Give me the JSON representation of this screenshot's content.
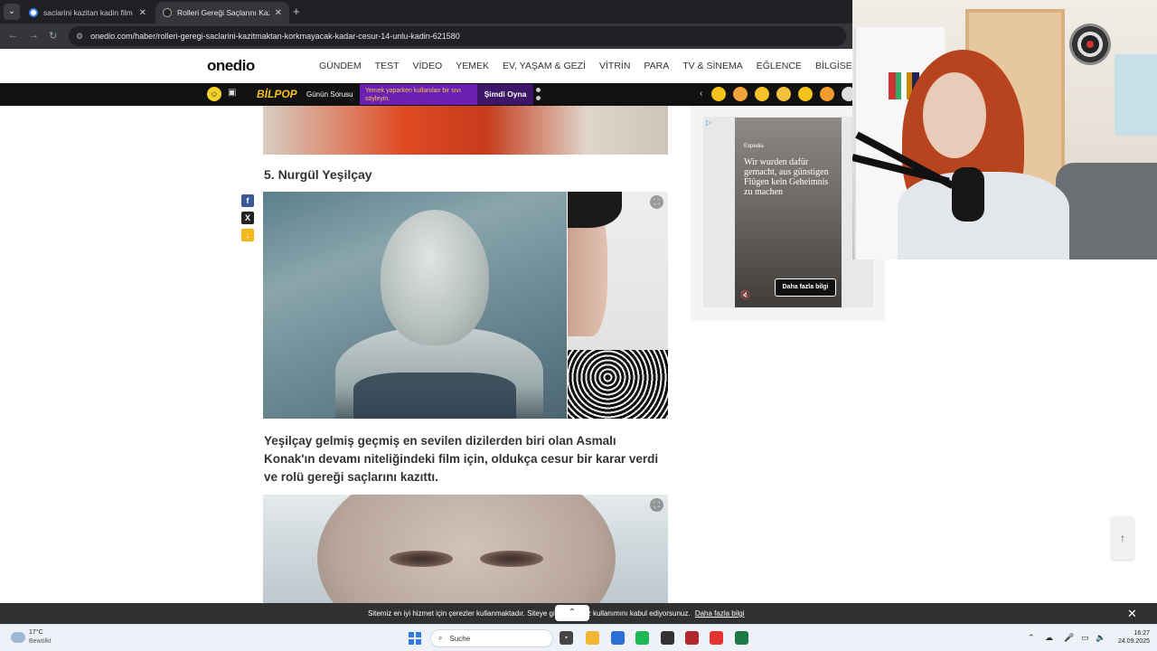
{
  "browser": {
    "tabs": [
      {
        "title": "saclarini kazitan kadin film kara",
        "active": false
      },
      {
        "title": "Rolleri Gereği Saçlarını Kazıtm",
        "active": true
      }
    ],
    "new_tab_icon": "+",
    "url": "onedio.com/haber/rolleri-geregi-saclarini-kazitmaktan-korkmayacak-kadar-cesur-14-unlu-kadin-621580"
  },
  "site": {
    "logo": "onedio",
    "nav": [
      "GÜNDEM",
      "TEST",
      "VİDEO",
      "YEMEK",
      "EV, YAŞAM & GEZİ",
      "VİTRİN",
      "PARA",
      "TV & SİNEMA",
      "EĞLENCE",
      "BİLGİSEL"
    ]
  },
  "promo": {
    "brand": "BİLPOP",
    "label": "Günün Sorusu",
    "question": "Yemek yaparken kullanılan bir sıvı söyleyin.",
    "play_label": "Şimdi Oyna",
    "emoji_colors": [
      "#f6c21c",
      "#f2a33a",
      "#f5c22a",
      "#f3c13e",
      "#f6c21c",
      "#f29a2e",
      "#dddddd"
    ]
  },
  "article": {
    "subheading": "5. Nurgül Yeşilçay",
    "paragraph": "Yeşilçay gelmiş geçmiş en sevilen dizilerden biri olan Asmalı Konak'ın devamı niteliğindeki film için, oldukça cesur bir karar verdi ve rolü gereği saçlarını kazıttı.",
    "share": [
      {
        "icon": "facebook-icon",
        "glyph": "f",
        "color": "#3b5998"
      },
      {
        "icon": "x-icon",
        "glyph": "X",
        "color": "#222222"
      },
      {
        "icon": "download-icon",
        "glyph": "↓",
        "color": "#f3b71b"
      }
    ]
  },
  "ad": {
    "brand": "Expedia",
    "copy": "Wir wurden dafür gemacht, aus günstigen Flügen kein Geheimnis zu machen",
    "cta": "Daha fazla bilgi"
  },
  "cookie": {
    "message": "Sitemiz en iyi hizmet için çerezler kullanmaktadır. Siteye girerek çerez kullanımını kabul ediyorsunuz.",
    "link": "Daha fazla bilgi",
    "close_glyph": "✕"
  },
  "taskbar": {
    "temperature": "17°C",
    "condition": "Bewölkt",
    "search_placeholder": "Suche",
    "time": "16:27",
    "date": "24.09.2025",
    "apps": [
      {
        "icon": "file-explorer-icon",
        "color": "#f2b632"
      },
      {
        "icon": "store-icon",
        "color": "#2b6fd6"
      },
      {
        "icon": "spotify-icon",
        "color": "#1db954"
      },
      {
        "icon": "obs-icon",
        "color": "#333333"
      },
      {
        "icon": "video-app-icon",
        "color": "#b0282d"
      },
      {
        "icon": "chrome-icon",
        "color": "#e3342f"
      },
      {
        "icon": "excel-icon",
        "color": "#1e7a45"
      }
    ]
  }
}
